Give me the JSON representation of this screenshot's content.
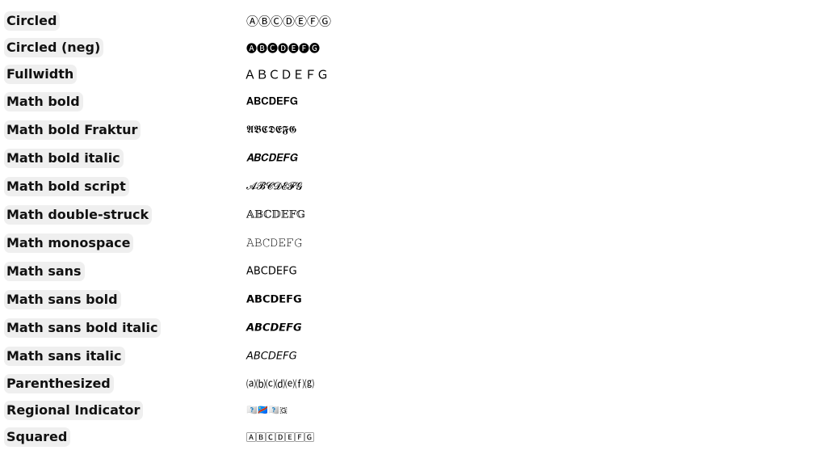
{
  "rows": [
    {
      "label": "Circled",
      "sample": "ⒶⒷⒸⒹⒺⒻⒼ"
    },
    {
      "label": "Circled (neg)",
      "sample": "🅐🅑🅒🅓🅔🅕🅖"
    },
    {
      "label": "Fullwidth",
      "sample": "ＡＢＣＤＥＦＧ"
    },
    {
      "label": "Math bold",
      "sample": "𝐀𝐁𝐂𝐃𝐄𝐅𝐆"
    },
    {
      "label": "Math bold Fraktur",
      "sample": "𝕬𝕭𝕮𝕯𝕰𝕱𝕲"
    },
    {
      "label": "Math bold italic",
      "sample": "𝑨𝑩𝑪𝑫𝑬𝑭𝑮"
    },
    {
      "label": "Math bold script",
      "sample": "𝓐𝓑𝓒𝓓𝓔𝓕𝓖"
    },
    {
      "label": "Math double-struck",
      "sample": "𝔸𝔹ℂ𝔻𝔼𝔽𝔾"
    },
    {
      "label": "Math monospace",
      "sample": "𝙰𝙱𝙲𝙳𝙴𝙵𝙶"
    },
    {
      "label": "Math sans",
      "sample": "𝖠𝖡𝖢𝖣𝖤𝖥𝖦"
    },
    {
      "label": "Math sans bold",
      "sample": "𝗔𝗕𝗖𝗗𝗘𝗙𝗚"
    },
    {
      "label": "Math sans bold italic",
      "sample": "𝘼𝘽𝘾𝘿𝙀𝙁𝙂"
    },
    {
      "label": "Math sans italic",
      "sample": "𝘈𝘉𝘊𝘋𝘌𝘍𝘎"
    },
    {
      "label": "Parenthesized",
      "sample": "⒜⒝⒞⒟⒠⒡⒢"
    },
    {
      "label": "Regional Indicator",
      "sample": "🇦🇧🇨🇩🇪🇫🇬"
    },
    {
      "label": "Squared",
      "sample": "🄰🄱🄲🄳🄴🄵🄶"
    }
  ]
}
